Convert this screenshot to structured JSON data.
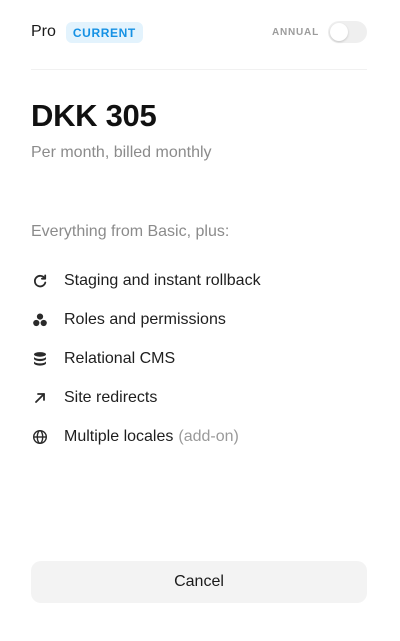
{
  "plan": {
    "name": "Pro",
    "badge": "CURRENT",
    "annual_label": "ANNUAL",
    "annual_enabled": false,
    "price": "DKK 305",
    "billing_note": "Per month, billed monthly"
  },
  "features": {
    "intro": "Everything from Basic, plus:",
    "items": [
      {
        "icon": "rollback-icon",
        "label": "Staging and instant rollback",
        "note": ""
      },
      {
        "icon": "roles-icon",
        "label": "Roles and permissions",
        "note": ""
      },
      {
        "icon": "database-icon",
        "label": "Relational CMS",
        "note": ""
      },
      {
        "icon": "redirect-arrow-icon",
        "label": "Site redirects",
        "note": ""
      },
      {
        "icon": "globe-icon",
        "label": "Multiple locales",
        "note": "(add-on)"
      }
    ]
  },
  "actions": {
    "cancel_label": "Cancel"
  },
  "colors": {
    "accent": "#1591e4",
    "badge_bg": "#e3f3fd",
    "muted_text": "#8b8b8b"
  }
}
